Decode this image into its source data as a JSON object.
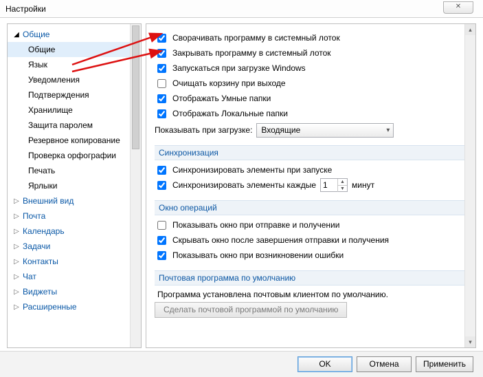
{
  "title": "Настройки",
  "sidebar": {
    "items": [
      {
        "label": "Общие",
        "kind": "parent",
        "expanded": true
      },
      {
        "label": "Общие",
        "kind": "child",
        "selected": true
      },
      {
        "label": "Язык",
        "kind": "child"
      },
      {
        "label": "Уведомления",
        "kind": "child"
      },
      {
        "label": "Подтверждения",
        "kind": "child"
      },
      {
        "label": "Хранилище",
        "kind": "child"
      },
      {
        "label": "Защита паролем",
        "kind": "child"
      },
      {
        "label": "Резервное копирование",
        "kind": "child"
      },
      {
        "label": "Проверка орфографии",
        "kind": "child"
      },
      {
        "label": "Печать",
        "kind": "child"
      },
      {
        "label": "Ярлыки",
        "kind": "child"
      },
      {
        "label": "Внешний вид",
        "kind": "parent"
      },
      {
        "label": "Почта",
        "kind": "parent"
      },
      {
        "label": "Календарь",
        "kind": "parent"
      },
      {
        "label": "Задачи",
        "kind": "parent"
      },
      {
        "label": "Контакты",
        "kind": "parent"
      },
      {
        "label": "Чат",
        "kind": "parent"
      },
      {
        "label": "Виджеты",
        "kind": "parent"
      },
      {
        "label": "Расширенные",
        "kind": "parent"
      }
    ]
  },
  "general": {
    "opts": [
      {
        "label": "Сворачивать программу в системный лоток",
        "checked": true
      },
      {
        "label": "Закрывать программу в системный лоток",
        "checked": true
      },
      {
        "label": "Запускаться при загрузке Windows",
        "checked": true
      },
      {
        "label": "Очищать корзину при выходе",
        "checked": false
      },
      {
        "label": "Отображать Умные папки",
        "checked": true
      },
      {
        "label": "Отображать Локальные папки",
        "checked": true
      }
    ],
    "startup_label": "Показывать при загрузке:",
    "startup_value": "Входящие"
  },
  "sync": {
    "header": "Синхронизация",
    "opts": [
      {
        "label": "Синхронизировать элементы при запуске",
        "checked": true
      }
    ],
    "every_pre": "Синхронизировать элементы каждые",
    "every_value": "1",
    "every_post": "минут",
    "every_checked": true
  },
  "opwin": {
    "header": "Окно операций",
    "opts": [
      {
        "label": "Показывать окно при отправке и получении",
        "checked": false
      },
      {
        "label": "Скрывать окно после завершения отправки и получения",
        "checked": true
      },
      {
        "label": "Показывать окно при возникновении ошибки",
        "checked": true
      }
    ]
  },
  "defaultmail": {
    "header": "Почтовая программа по умолчанию",
    "status": "Программа установлена почтовым клиентом по умолчанию.",
    "button": "Сделать почтовой программой по умолчанию"
  },
  "buttons": {
    "ok": "OK",
    "cancel": "Отмена",
    "apply": "Применить"
  }
}
